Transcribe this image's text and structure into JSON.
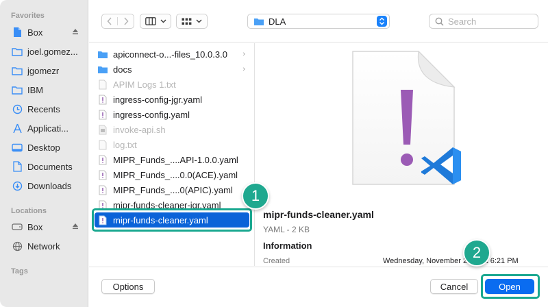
{
  "sidebar": {
    "favorites_title": "Favorites",
    "favorites": [
      {
        "label": "Box",
        "icon": "document-icon"
      },
      {
        "label": "joel.gomez...",
        "icon": "folder-icon"
      },
      {
        "label": "jgomezr",
        "icon": "folder-icon"
      },
      {
        "label": "IBM",
        "icon": "folder-icon"
      },
      {
        "label": "Recents",
        "icon": "clock-icon"
      },
      {
        "label": "Applicati...",
        "icon": "applications-icon"
      },
      {
        "label": "Desktop",
        "icon": "desktop-icon"
      },
      {
        "label": "Documents",
        "icon": "document-icon"
      },
      {
        "label": "Downloads",
        "icon": "download-icon"
      }
    ],
    "locations_title": "Locations",
    "locations": [
      {
        "label": "Box",
        "icon": "drive-icon"
      },
      {
        "label": "Network",
        "icon": "globe-icon"
      }
    ],
    "tags_title": "Tags"
  },
  "toolbar": {
    "location": "DLA",
    "search_placeholder": "Search"
  },
  "files": [
    {
      "name": "apiconnect-o...-files_10.0.3.0",
      "type": "folder",
      "dim": false
    },
    {
      "name": "docs",
      "type": "folder",
      "dim": false
    },
    {
      "name": "APIM Logs 1.txt",
      "type": "text",
      "dim": true
    },
    {
      "name": "ingress-config-jgr.yaml",
      "type": "yaml",
      "dim": false
    },
    {
      "name": "ingress-config.yaml",
      "type": "yaml",
      "dim": false
    },
    {
      "name": "invoke-api.sh",
      "type": "script",
      "dim": true
    },
    {
      "name": "log.txt",
      "type": "text",
      "dim": true
    },
    {
      "name": "MIPR_Funds_....API-1.0.0.yaml",
      "type": "yaml",
      "dim": false
    },
    {
      "name": "MIPR_Funds_....0.0(ACE).yaml",
      "type": "yaml",
      "dim": false
    },
    {
      "name": "MIPR_Funds_....0(APIC).yaml",
      "type": "yaml",
      "dim": false
    },
    {
      "name": "mipr-funds-cleaner-jgr.yaml",
      "type": "yaml",
      "dim": false
    },
    {
      "name": "mipr-funds-cleaner.yaml",
      "type": "yaml",
      "dim": false,
      "selected": true
    }
  ],
  "preview": {
    "name": "mipr-funds-cleaner.yaml",
    "kind": "YAML - 2 KB",
    "info_title": "Information",
    "created_label": "Created",
    "created_value": "Wednesday, November 2021 at 6:21 PM"
  },
  "footer": {
    "options_label": "Options",
    "cancel_label": "Cancel",
    "open_label": "Open"
  },
  "callouts": {
    "one": "1",
    "two": "2"
  },
  "colors": {
    "accent": "#0a6cf0",
    "highlight": "#1aa890",
    "selection": "#0b63d8"
  }
}
